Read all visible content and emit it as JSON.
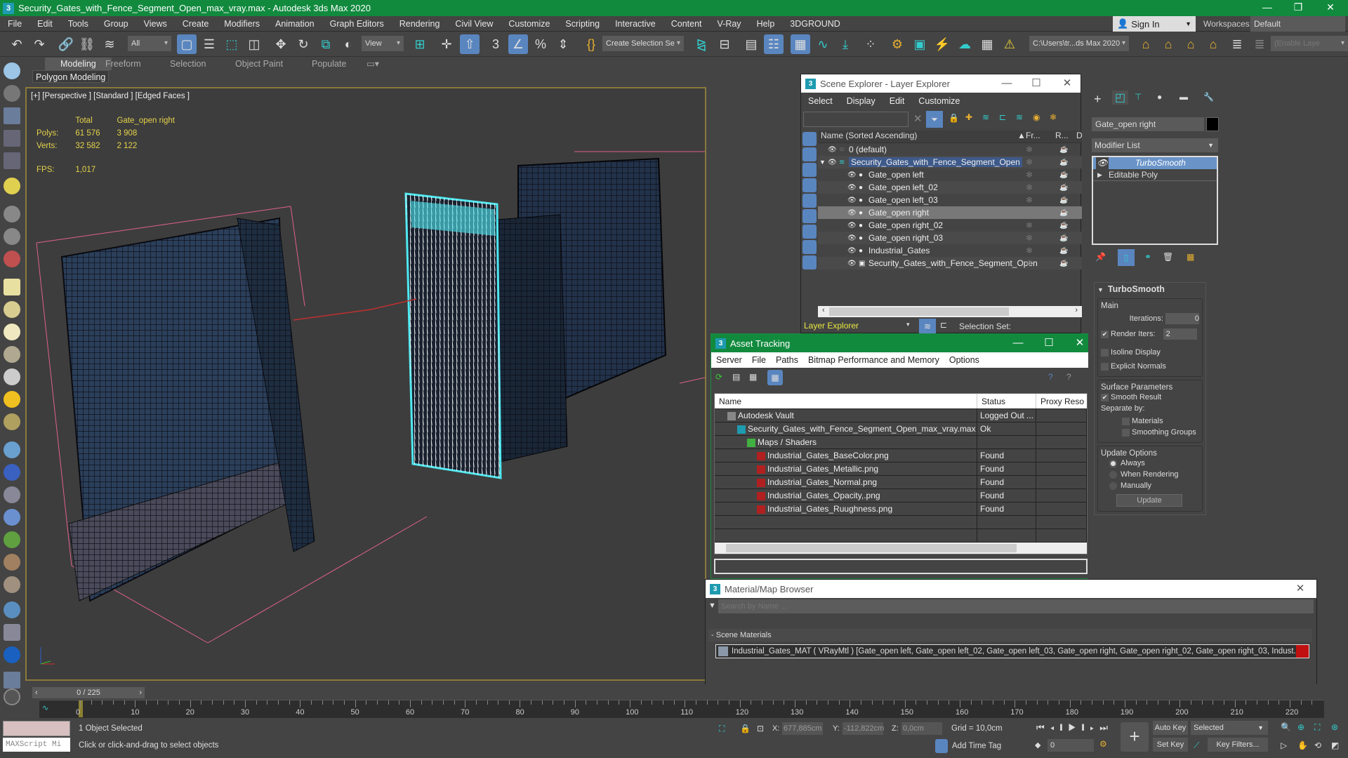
{
  "app": {
    "title": "Security_Gates_with_Fence_Segment_Open_max_vray.max - Autodesk 3ds Max 2020",
    "icon": "3",
    "window_controls": {
      "minimize": "—",
      "maximize": "❐",
      "close": "✕"
    }
  },
  "menu": [
    "File",
    "Edit",
    "Tools",
    "Group",
    "Views",
    "Create",
    "Modifiers",
    "Animation",
    "Graph Editors",
    "Rendering",
    "Civil View",
    "Customize",
    "Scripting",
    "Interactive",
    "Content",
    "V-Ray",
    "Help",
    "3DGROUND"
  ],
  "account": {
    "sign_in": "Sign In",
    "workspaces_label": "Workspaces:",
    "workspace_value": "Default"
  },
  "toolbar": {
    "selection_filter": "All",
    "ref_coord": "View",
    "selection_set": "Create Selection Se",
    "project_path": "C:\\Users\\tr...ds Max 2020",
    "layer_field_placeholder": "(Enable Laye"
  },
  "ribbon": {
    "tabs": [
      "Modeling",
      "Freeform",
      "Selection",
      "Object Paint",
      "Populate"
    ],
    "active_tab": "Modeling",
    "panel": "Polygon Modeling"
  },
  "viewport": {
    "label": "[+] [Perspective ] [Standard ] [Edged Faces ]",
    "stats": {
      "col_total": "Total",
      "col_selected": "Gate_open right",
      "polys_label": "Polys:",
      "polys_total": "61 576",
      "polys_sel": "3 908",
      "verts_label": "Verts:",
      "verts_total": "32 582",
      "verts_sel": "2 122",
      "fps_label": "FPS:",
      "fps": "1,017"
    },
    "accent_selected": "#4fe8f0"
  },
  "scene_explorer": {
    "title": "Scene Explorer - Layer Explorer",
    "menu": [
      "Select",
      "Display",
      "Edit",
      "Customize"
    ],
    "columns": {
      "name": "Name (Sorted Ascending)",
      "frozen": "Fr...",
      "render": "R...",
      "display": "D"
    },
    "rows": [
      {
        "name": "0 (default)",
        "level": 0,
        "type": "layer"
      },
      {
        "name": "Security_Gates_with_Fence_Segment_Open",
        "level": 0,
        "type": "layer-active",
        "expanded": true
      },
      {
        "name": "Gate_open left",
        "level": 1,
        "type": "object"
      },
      {
        "name": "Gate_open left_02",
        "level": 1,
        "type": "object"
      },
      {
        "name": "Gate_open left_03",
        "level": 1,
        "type": "object"
      },
      {
        "name": "Gate_open right",
        "level": 1,
        "type": "object",
        "selected": true
      },
      {
        "name": "Gate_open right_02",
        "level": 1,
        "type": "object"
      },
      {
        "name": "Gate_open right_03",
        "level": 1,
        "type": "object"
      },
      {
        "name": "Industrial_Gates",
        "level": 1,
        "type": "object"
      },
      {
        "name": "Security_Gates_with_Fence_Segment_Open",
        "level": 1,
        "type": "group"
      }
    ],
    "footer": {
      "explorer": "Layer Explorer",
      "selection_set": "Selection Set:"
    }
  },
  "asset_tracking": {
    "title": "Asset Tracking",
    "menu": [
      "Server",
      "File",
      "Paths",
      "Bitmap Performance and Memory",
      "Options"
    ],
    "columns": [
      "Name",
      "Status",
      "Proxy Reso"
    ],
    "rows": [
      {
        "name": "Autodesk Vault",
        "status": "Logged Out ...",
        "indent": 1,
        "icon": "vault"
      },
      {
        "name": "Security_Gates_with_Fence_Segment_Open_max_vray.max",
        "status": "Ok",
        "indent": 2,
        "icon": "max"
      },
      {
        "name": "Maps / Shaders",
        "status": "",
        "indent": 3,
        "icon": "maps"
      },
      {
        "name": "Industrial_Gates_BaseColor.png",
        "status": "Found",
        "indent": 4,
        "icon": "bitmap"
      },
      {
        "name": "Industrial_Gates_Metallic.png",
        "status": "Found",
        "indent": 4,
        "icon": "bitmap"
      },
      {
        "name": "Industrial_Gates_Normal.png",
        "status": "Found",
        "indent": 4,
        "icon": "bitmap"
      },
      {
        "name": "Industrial_Gates_Opacity,.png",
        "status": "Found",
        "indent": 4,
        "icon": "bitmap"
      },
      {
        "name": "Industrial_Gates_Ruughness.png",
        "status": "Found",
        "indent": 4,
        "icon": "bitmap"
      }
    ]
  },
  "material_browser": {
    "title": "Material/Map Browser",
    "search_placeholder": "Search by Name ...",
    "section": "Scene Materials",
    "item": "Industrial_Gates_MAT ( VRayMtl ) [Gate_open left, Gate_open left_02, Gate_open left_03, Gate_open right, Gate_open right_02, Gate_open right_03, Indust..."
  },
  "command_panel": {
    "object_name": "Gate_open right",
    "modifier_list": "Modifier List",
    "stack": [
      "TurboSmooth",
      "Editable Poly"
    ],
    "rollout": {
      "title": "TurboSmooth",
      "main": "Main",
      "iterations_label": "Iterations:",
      "iterations": "0",
      "render_iters_label": "Render Iters:",
      "render_iters": "2",
      "render_iters_checked": true,
      "isoline": "Isoline Display",
      "explicit_normals": "Explicit Normals",
      "surface": "Surface Parameters",
      "smooth_result": "Smooth Result",
      "separate_by": "Separate by:",
      "materials": "Materials",
      "smoothing_groups": "Smoothing Groups",
      "update_options": "Update Options",
      "always": "Always",
      "when_rendering": "When Rendering",
      "manually": "Manually",
      "update_button": "Update"
    }
  },
  "timeline": {
    "frame_display": "0 / 225",
    "ticks": [
      "0",
      "10",
      "20",
      "30",
      "40",
      "50",
      "60",
      "70",
      "80",
      "90",
      "100",
      "110",
      "120",
      "130",
      "140",
      "150",
      "160",
      "170",
      "180",
      "190",
      "200",
      "210",
      "220"
    ]
  },
  "status": {
    "selected": "1 Object Selected",
    "prompt": "Click or click-and-drag to select objects",
    "maxscript": "MAXScript Mi",
    "x_label": "X:",
    "x": "677,885cm",
    "y_label": "Y:",
    "y": "-112,822cm",
    "z_label": "Z:",
    "z": "0,0cm",
    "grid": "Grid = 10,0cm",
    "add_time_tag": "Add Time Tag",
    "auto_key": "Auto Key",
    "set_key": "Set Key",
    "key_mode": "Selected",
    "key_filters": "Key Filters...",
    "current_frame": "0"
  }
}
